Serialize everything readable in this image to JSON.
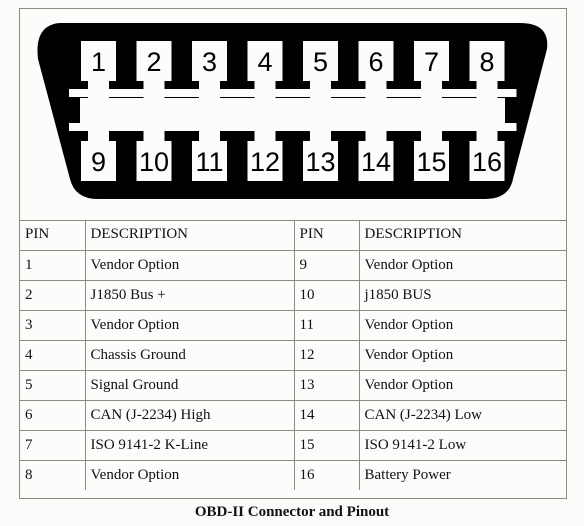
{
  "connector": {
    "top_row_pins": [
      "1",
      "2",
      "3",
      "4",
      "5",
      "6",
      "7",
      "8"
    ],
    "bottom_row_pins": [
      "9",
      "10",
      "11",
      "12",
      "13",
      "14",
      "15",
      "16"
    ]
  },
  "table": {
    "headers": [
      "PIN",
      "DESCRIPTION",
      "PIN",
      "DESCRIPTION"
    ],
    "rows": [
      {
        "pin_a": "1",
        "desc_a": "Vendor Option",
        "pin_b": "9",
        "desc_b": "Vendor Option"
      },
      {
        "pin_a": "2",
        "desc_a": "J1850 Bus +",
        "pin_b": "10",
        "desc_b": "j1850 BUS"
      },
      {
        "pin_a": "3",
        "desc_a": "Vendor Option",
        "pin_b": "11",
        "desc_b": "Vendor Option"
      },
      {
        "pin_a": "4",
        "desc_a": "Chassis Ground",
        "pin_b": "12",
        "desc_b": "Vendor Option"
      },
      {
        "pin_a": "5",
        "desc_a": "Signal Ground",
        "pin_b": "13",
        "desc_b": "Vendor Option"
      },
      {
        "pin_a": "6",
        "desc_a": "CAN (J-2234) High",
        "pin_b": "14",
        "desc_b": "CAN (J-2234) Low"
      },
      {
        "pin_a": "7",
        "desc_a": "ISO 9141-2 K-Line",
        "pin_b": "15",
        "desc_b": "ISO 9141-2 Low"
      },
      {
        "pin_a": "8",
        "desc_a": "Vendor Option",
        "pin_b": "16",
        "desc_b": "Battery Power"
      }
    ]
  },
  "caption": "OBD-II Connector and Pinout",
  "colors": {
    "connector": "#000000",
    "border": "#8a8a84",
    "background": "#fbfbf9"
  }
}
